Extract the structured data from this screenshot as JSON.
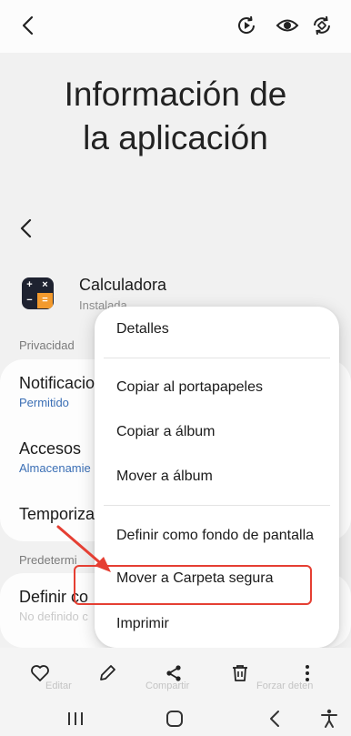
{
  "header": {
    "title": "Información de la aplicación"
  },
  "app": {
    "name": "Calculadora",
    "status": "Instalada"
  },
  "sections": {
    "privacy_label": "Privacidad",
    "defaults_label": "Predetermi",
    "notifications": {
      "title": "Notificacio",
      "value": "Permitido"
    },
    "access": {
      "title": "Accesos",
      "value": "Almacenamie"
    },
    "timer": {
      "title": "Temporiza"
    },
    "default_app": {
      "title": "Definir co",
      "value": "No definido c"
    }
  },
  "context_menu": {
    "items": [
      "Detalles",
      "Copiar al portapapeles",
      "Copiar a álbum",
      "Mover a álbum",
      "Definir como fondo de pantalla",
      "Mover a Carpeta segura",
      "Imprimir"
    ]
  },
  "toolbar": {
    "ghost_labels": [
      "Editar",
      "Compartir",
      "Forzar deten"
    ]
  },
  "colors": {
    "accent": "#e53f33",
    "link": "#3b6fb5",
    "app_icon_operator": "#f39a2d"
  },
  "icons": {
    "top_bar": [
      "back-arrow-icon",
      "play-rotate-icon",
      "eye-icon",
      "rotate-icon"
    ],
    "toolbar": [
      "heart-icon",
      "pencil-icon",
      "share-icon",
      "trash-icon",
      "more-vertical-icon"
    ],
    "nav": [
      "recents-icon",
      "home-icon",
      "nav-back-icon",
      "accessibility-icon"
    ]
  }
}
